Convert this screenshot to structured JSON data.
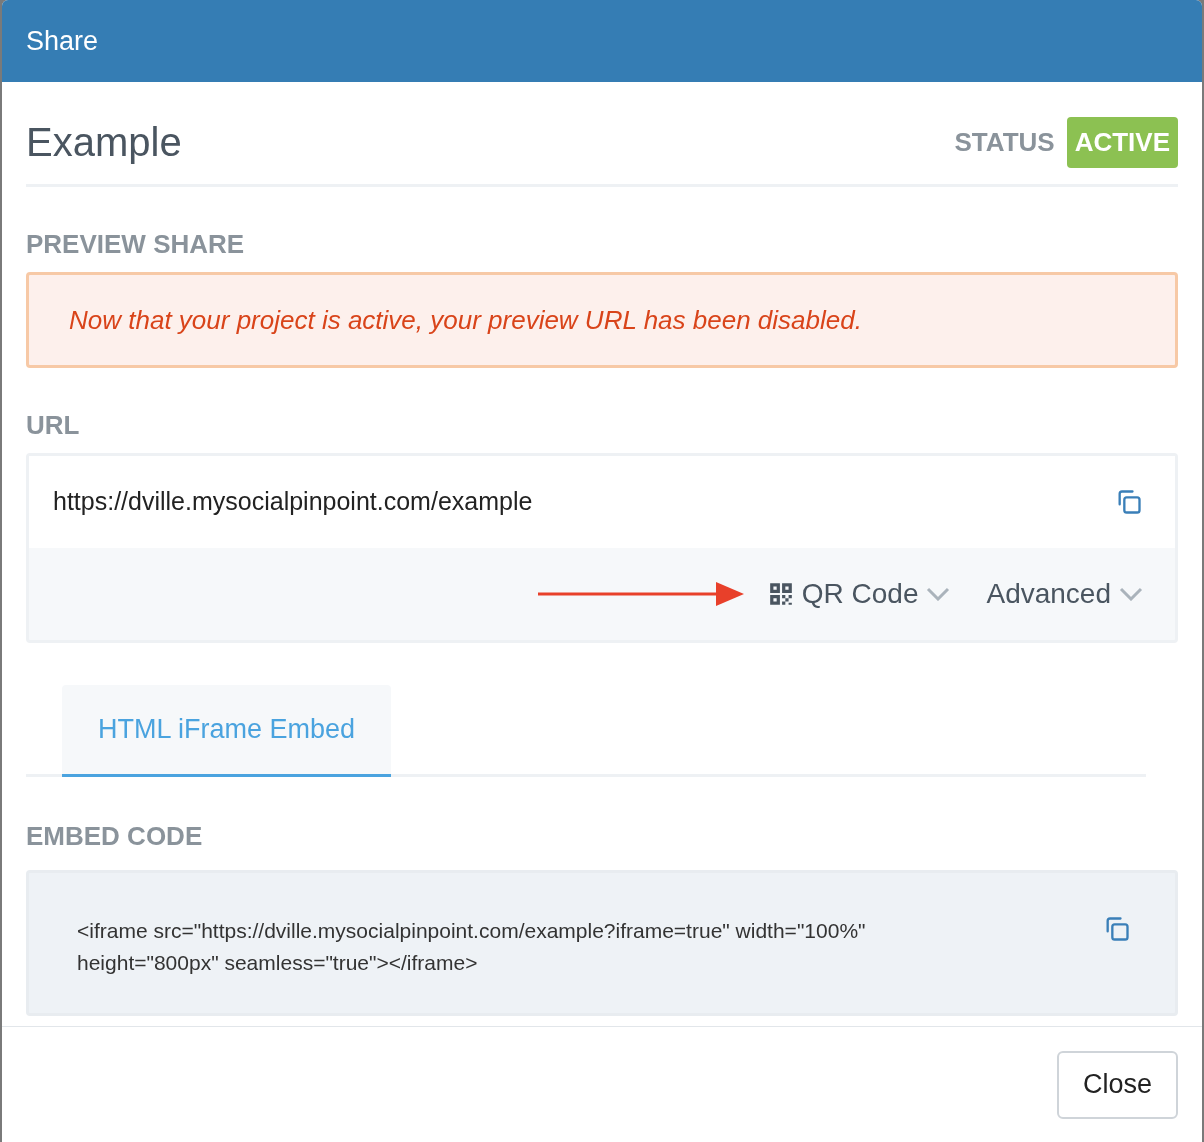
{
  "dialog": {
    "title": "Share"
  },
  "project": {
    "name": "Example",
    "status_label": "STATUS",
    "status": "ACTIVE"
  },
  "preview": {
    "heading": "PREVIEW SHARE",
    "alert": "Now that your project is active, your preview URL has been disabled."
  },
  "url": {
    "heading": "URL",
    "value": "https://dville.mysocialpinpoint.com/example",
    "options": [
      {
        "label": "QR Code",
        "kind": "qr",
        "expanded": false
      },
      {
        "label": "Advanced",
        "kind": "plain",
        "expanded": false
      }
    ]
  },
  "tabs": [
    {
      "label": "HTML iFrame Embed",
      "selected": true
    }
  ],
  "embed": {
    "heading": "EMBED CODE",
    "code": "<iframe src=\"https://dville.mysocialpinpoint.com/example?iframe=true\" width=\"100%\" height=\"800px\" seamless=\"true\"></iframe>"
  },
  "buttons": [
    "Close"
  ]
}
